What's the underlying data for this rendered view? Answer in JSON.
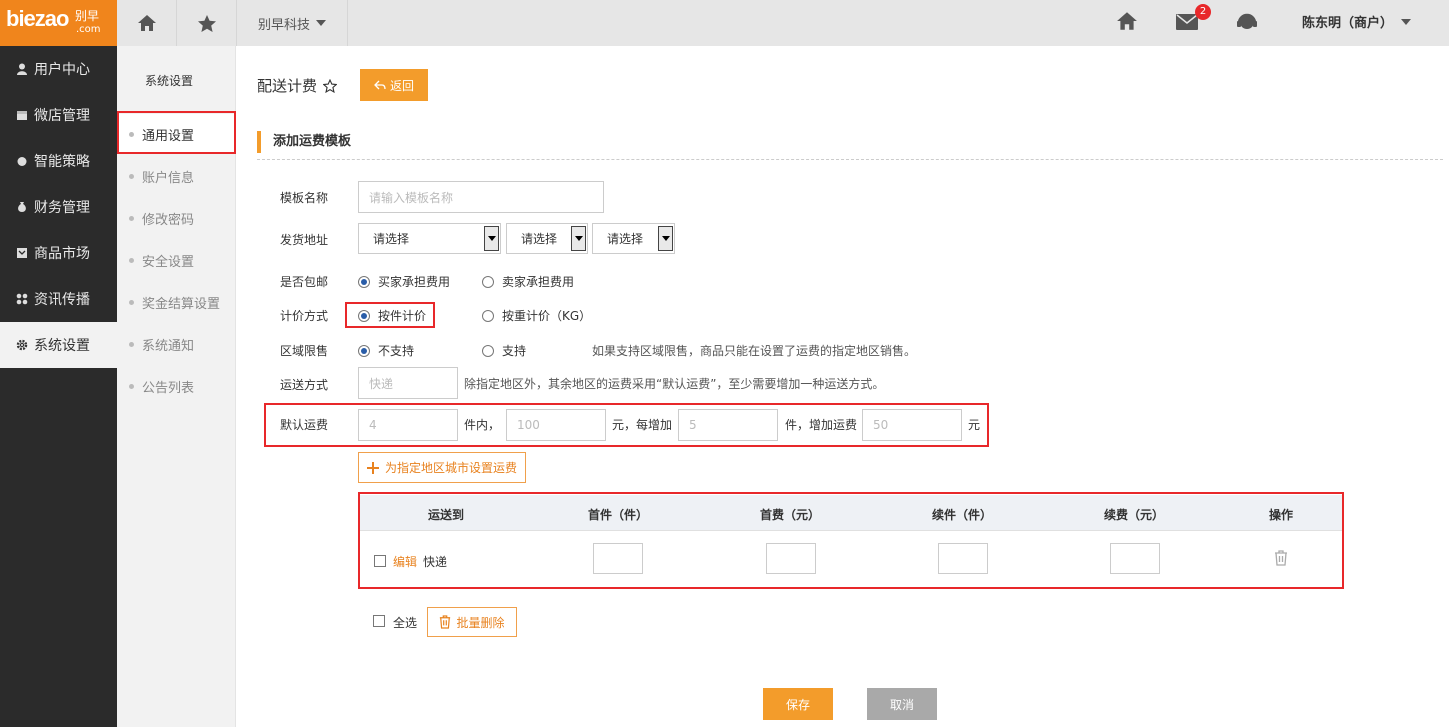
{
  "brand": {
    "logo_text": "biezao",
    "logo_cn": "别早",
    "logo_domain": ".com",
    "accent": "#f39c2b"
  },
  "topbar": {
    "company": "别早科技",
    "mail_badge": "2",
    "user": "陈东明（商户）"
  },
  "sidebar": {
    "items": [
      {
        "label": "用户中心"
      },
      {
        "label": "微店管理"
      },
      {
        "label": "智能策略"
      },
      {
        "label": "财务管理"
      },
      {
        "label": "商品市场"
      },
      {
        "label": "资讯传播"
      },
      {
        "label": "系统设置"
      }
    ]
  },
  "subsidebar": {
    "title": "系统设置",
    "items": [
      {
        "label": "通用设置"
      },
      {
        "label": "账户信息"
      },
      {
        "label": "修改密码"
      },
      {
        "label": "安全设置"
      },
      {
        "label": "奖金结算设置"
      },
      {
        "label": "系统通知"
      },
      {
        "label": "公告列表"
      }
    ]
  },
  "page": {
    "title": "配送计费",
    "back_label": "返回",
    "section": "添加运费模板"
  },
  "form": {
    "name_label": "模板名称",
    "name_placeholder": "请输入模板名称",
    "address_label": "发货地址",
    "address_selects": [
      "请选择",
      "请选择",
      "请选择"
    ],
    "free_label": "是否包邮",
    "free_opt1": "买家承担费用",
    "free_opt2": "卖家承担费用",
    "calc_label": "计价方式",
    "calc_opt1": "按件计价",
    "calc_opt2": "按重计价（KG）",
    "region_label": "区域限售",
    "region_opt1": "不支持",
    "region_opt2": "支持",
    "region_hint": "如果支持区域限售，商品只能在设置了运费的指定地区销售。",
    "ship_label": "运送方式",
    "ship_placeholder": "快递",
    "ship_hint": "除指定地区外，其余地区的运费采用“默认运费”，至少需要增加一种运送方式。",
    "default_label": "默认运费",
    "default_first_qty": "4",
    "unit_within": "件内，",
    "default_first_fee": "100",
    "unit_each_add": "元，每增加",
    "default_add_qty": "5",
    "unit_add_fee": "件，增加运费",
    "default_add_fee": "50",
    "unit_yuan": "元",
    "add_city_label": "为指定地区城市设置运费"
  },
  "table": {
    "headers": [
      "运送到",
      "首件（件）",
      "首费（元）",
      "续件（件）",
      "续费（元）",
      "操作"
    ],
    "row": {
      "edit": "编辑",
      "method": "快递"
    }
  },
  "footer": {
    "select_all": "全选",
    "batch_delete": "批量删除",
    "save": "保存",
    "cancel": "取消"
  }
}
